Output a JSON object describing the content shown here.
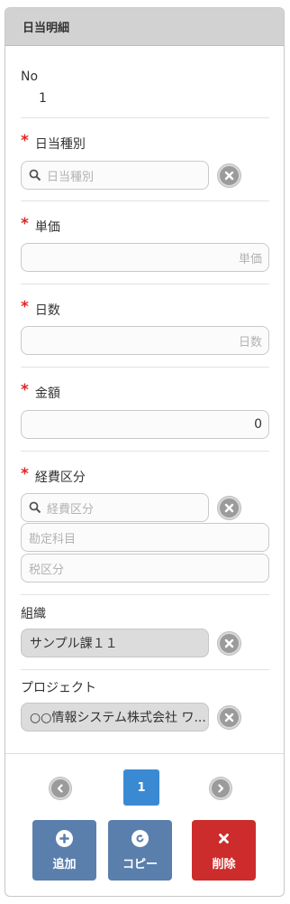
{
  "panel": {
    "title": "日当明細"
  },
  "no": {
    "label": "No",
    "value": "1"
  },
  "fields": {
    "allowance_type": {
      "label": "日当種別",
      "placeholder": "日当種別"
    },
    "unit_price": {
      "label": "単価",
      "placeholder": "単価"
    },
    "days": {
      "label": "日数",
      "placeholder": "日数"
    },
    "amount": {
      "label": "金額",
      "value": "0"
    },
    "expense_category": {
      "label": "経費区分",
      "placeholder": "経費区分",
      "account_placeholder": "勘定科目",
      "tax_placeholder": "税区分"
    },
    "organization": {
      "label": "組織",
      "value": "サンプル課１１"
    },
    "project": {
      "label": "プロジェクト",
      "value": "○○情報システム株式会社 ワ..."
    }
  },
  "required_mark": "*",
  "pagination": {
    "current": "1"
  },
  "actions": {
    "add": "追加",
    "copy": "コピー",
    "delete": "削除"
  },
  "icons": {
    "search": "magnifier-icon",
    "clear": "circle-x-icon",
    "prev": "circle-chevron-left-icon",
    "next": "circle-chevron-right-icon",
    "add": "plus-icon",
    "copy": "refresh-icon",
    "delete": "x-icon"
  },
  "colors": {
    "header_bg": "#d2d2d2",
    "required": "#e12626",
    "page_active": "#3a8ad3",
    "action_blue": "#5a7fad",
    "action_red": "#cd2c2c"
  }
}
